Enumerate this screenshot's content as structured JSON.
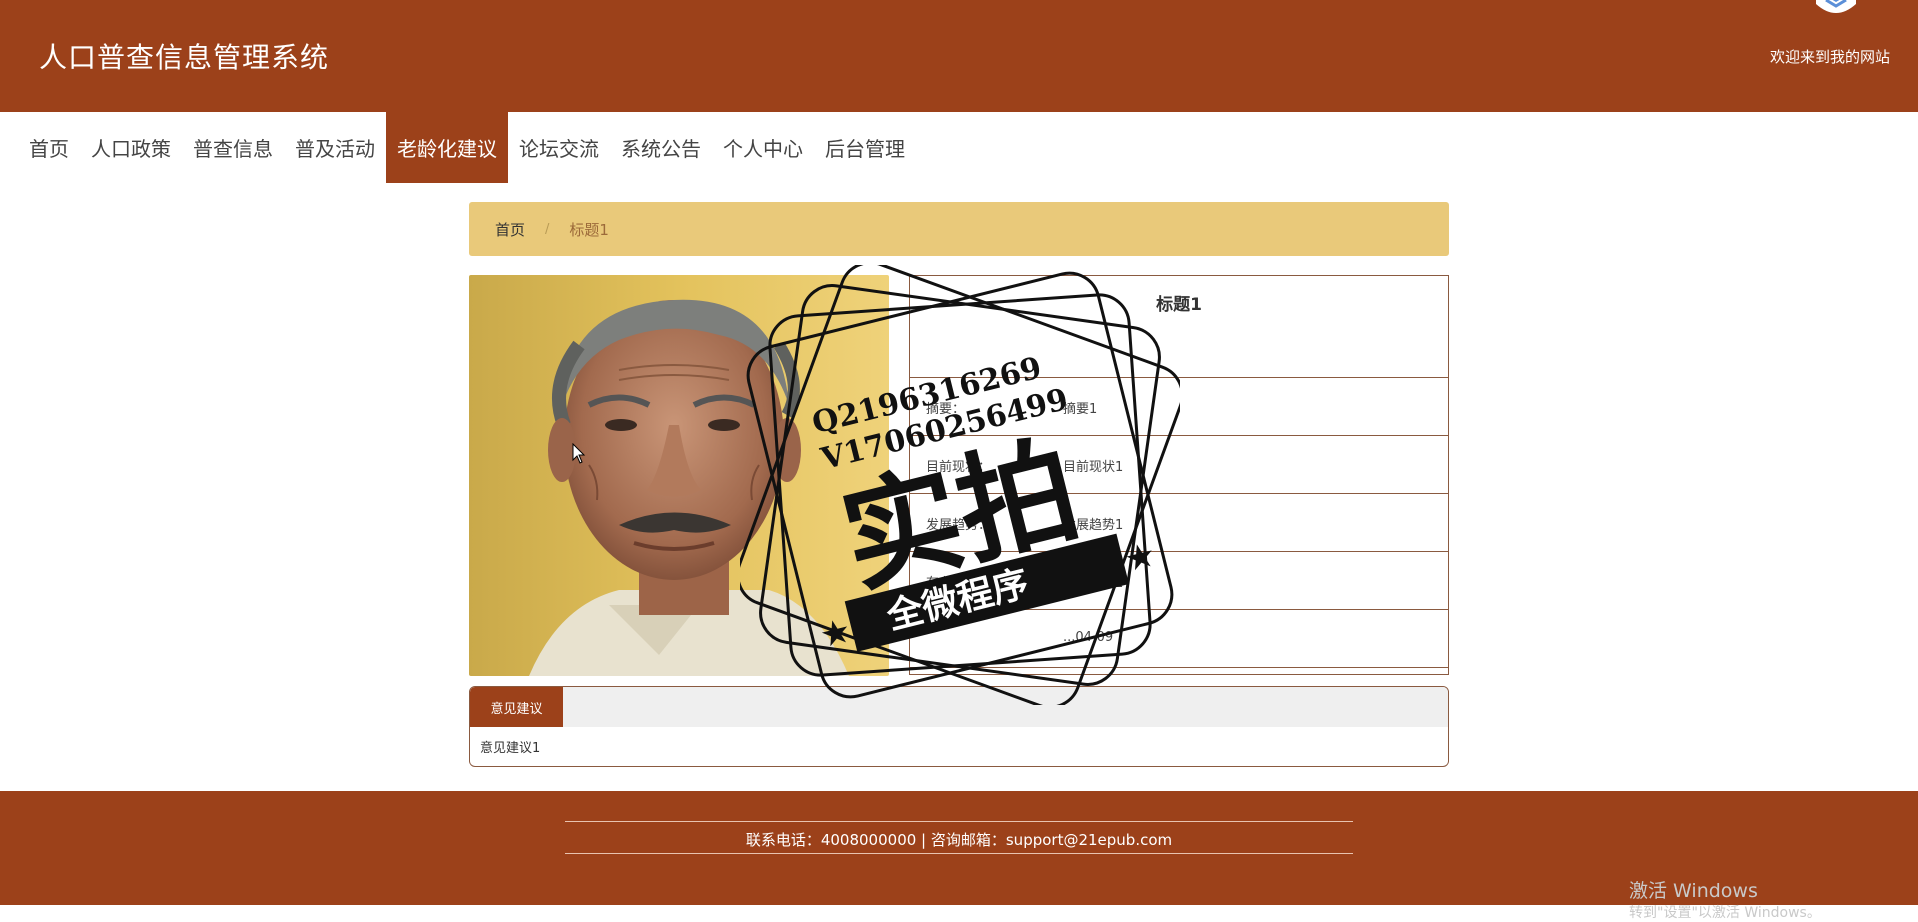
{
  "header": {
    "site_title": "人口普查信息管理系统",
    "welcome": "欢迎来到我的网站"
  },
  "nav": {
    "items": [
      {
        "label": "首页"
      },
      {
        "label": "人口政策"
      },
      {
        "label": "普查信息"
      },
      {
        "label": "普及活动"
      },
      {
        "label": "老龄化建议",
        "active": true
      },
      {
        "label": "论坛交流"
      },
      {
        "label": "系统公告"
      },
      {
        "label": "个人中心"
      },
      {
        "label": "后台管理"
      }
    ]
  },
  "breadcrumb": {
    "home": "首页",
    "separator": "/",
    "current": "标题1"
  },
  "detail": {
    "title": "标题1",
    "rows": [
      {
        "label": "摘要：",
        "value": "摘要1"
      },
      {
        "label": "目前现状：",
        "value": "目前现状1"
      },
      {
        "label": "发展趋势：",
        "value": "发展趋势1"
      },
      {
        "label": "存在问题：",
        "value": "存在问题1"
      },
      {
        "label": "",
        "value": "...04-09"
      }
    ]
  },
  "suggestions": {
    "tab_label": "意见建议",
    "content": "意见建议1"
  },
  "footer": {
    "contact": "联系电话：4008000000 | 咨询邮箱：support@21epub.com"
  },
  "watermark": {
    "line1": "Q2196316269",
    "line2": "V17060256499",
    "main": "实拍",
    "ribbon": "全微程序"
  },
  "windows_activation": {
    "title": "激活 Windows",
    "subtitle": "转到\"设置\"以激活 Windows。"
  },
  "colors": {
    "brand": "#9c411a",
    "breadcrumb_bg": "#e9c97a",
    "border": "#8a5a40"
  }
}
